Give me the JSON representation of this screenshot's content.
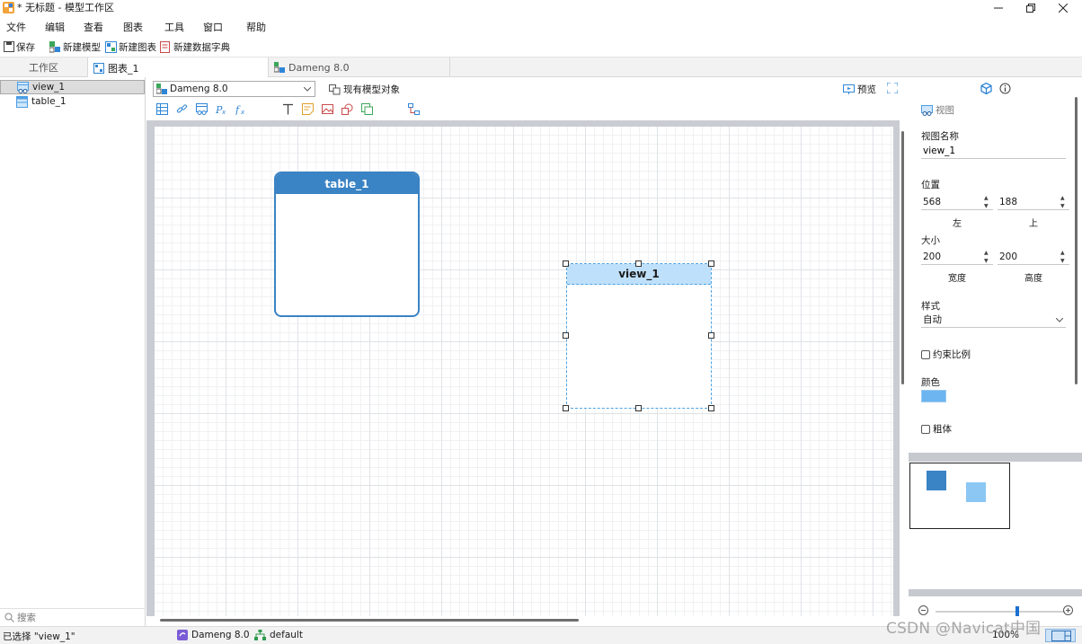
{
  "window": {
    "title": "* 无标题 - 模型工作区",
    "min_icon": "minimize-icon",
    "max_icon": "maximize-icon",
    "close_icon": "close-icon"
  },
  "menu": [
    "文件",
    "编辑",
    "查看",
    "图表",
    "工具",
    "窗口",
    "帮助"
  ],
  "toolbar": {
    "save": "保存",
    "new_model": "新建模型",
    "new_diagram": "新建图表",
    "new_dictionary": "新建数据字典"
  },
  "tabs": [
    {
      "label": "工作区",
      "icon": "workspace"
    },
    {
      "label": "图表_1",
      "icon": "diagram-icon"
    },
    {
      "label": "Dameng 8.0",
      "icon": "model-icon"
    }
  ],
  "tree": [
    {
      "label": "view_1",
      "icon": "view-icon",
      "selected": true
    },
    {
      "label": "table_1",
      "icon": "table-icon",
      "selected": false
    }
  ],
  "search": {
    "placeholder": "搜索"
  },
  "diagram_toolbar": {
    "db_select": "Dameng 8.0",
    "existing_objects": "现有模型对象",
    "preview": "预览",
    "fullscreen_icon": "fullscreen-icon"
  },
  "entities": {
    "table": {
      "name": "table_1",
      "color": "#3a83c4"
    },
    "view": {
      "name": "view_1",
      "color": "#bfe0fb"
    }
  },
  "properties": {
    "section": "视图",
    "name_label": "视图名称",
    "name_value": "view_1",
    "position_label": "位置",
    "pos_left": "568",
    "pos_top": "188",
    "left_label": "左",
    "top_label": "上",
    "size_label": "大小",
    "width": "200",
    "height": "200",
    "width_label": "宽度",
    "height_label": "高度",
    "style_label": "样式",
    "style_value": "自动",
    "constrain_label": "约束比例",
    "color_label": "颜色",
    "color_value": "#6cb5f0",
    "bold_label": "粗体"
  },
  "zoom": {
    "value": "100%",
    "level": 0.63
  },
  "status": {
    "selected": "已选择 \"view_1\"",
    "db": "Dameng 8.0",
    "schema": "default"
  },
  "watermark": "CSDN @Navicat中国"
}
